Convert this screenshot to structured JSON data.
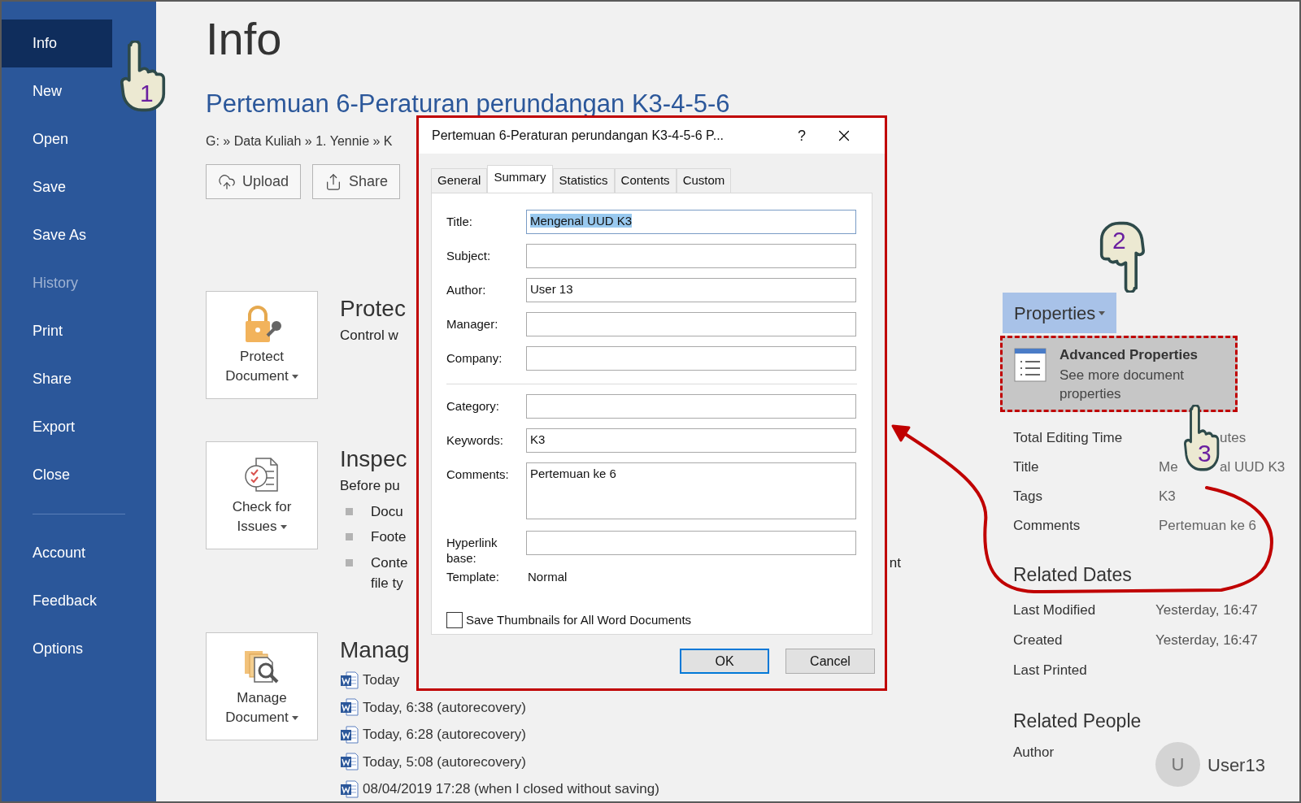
{
  "sidebar": {
    "items": [
      {
        "label": "Info",
        "selected": true,
        "disabled": false
      },
      {
        "label": "New",
        "selected": false,
        "disabled": false
      },
      {
        "label": "Open",
        "selected": false,
        "disabled": false
      },
      {
        "label": "Save",
        "selected": false,
        "disabled": false
      },
      {
        "label": "Save As",
        "selected": false,
        "disabled": false
      },
      {
        "label": "History",
        "selected": false,
        "disabled": true
      },
      {
        "label": "Print",
        "selected": false,
        "disabled": false
      },
      {
        "label": "Share",
        "selected": false,
        "disabled": false
      },
      {
        "label": "Export",
        "selected": false,
        "disabled": false
      },
      {
        "label": "Close",
        "selected": false,
        "disabled": false
      }
    ],
    "lower_items": [
      {
        "label": "Account",
        "selected": false,
        "disabled": false
      },
      {
        "label": "Feedback",
        "selected": false,
        "disabled": false
      },
      {
        "label": "Options",
        "selected": false,
        "disabled": false
      }
    ]
  },
  "page": {
    "heading": "Info",
    "document_title": "Pertemuan 6-Peraturan perundangan K3-4-5-6",
    "path": "G: » Data Kuliah » 1. Yennie » K",
    "actions": [
      {
        "label": "Upload",
        "kind": "upload"
      },
      {
        "label": "Share",
        "kind": "share"
      }
    ]
  },
  "sections": [
    {
      "kind": "protect",
      "tile": "Protect Document",
      "heading": "Protec",
      "lines": [
        "Control w"
      ]
    },
    {
      "kind": "inspect",
      "tile": "Check for Issues",
      "heading": "Inspec",
      "lines": [
        "Before pu"
      ],
      "bullets": [
        {
          "text": "Docu"
        },
        {
          "text": "Foote"
        },
        {
          "text": "Conte",
          "tail": "nt",
          "continuation": "file ty"
        }
      ]
    },
    {
      "kind": "manage",
      "tile": "Manage Document",
      "heading": "Manag",
      "versions": [
        "Today",
        "Today, 6:38 (autorecovery)",
        "Today, 6:28 (autorecovery)",
        "Today, 5:08 (autorecovery)",
        "08/04/2019 17:28 (when I closed without saving)"
      ]
    }
  ],
  "properties": {
    "button": "Properties",
    "menu_item": {
      "title": "Advanced Properties",
      "description": "See more document properties",
      "highlighted": true
    },
    "rows": [
      {
        "label": "Total Editing Time",
        "value_tail": "utes"
      },
      {
        "label": "Title",
        "value": "Me",
        "value_tail": "al UUD K3"
      },
      {
        "label": "Tags",
        "value": "K3"
      },
      {
        "label": "Comments",
        "value": "Pertemuan ke 6"
      }
    ]
  },
  "related_dates": {
    "heading": "Related Dates",
    "rows": [
      {
        "label": "Last Modified",
        "value": "Yesterday, 16:47"
      },
      {
        "label": "Created",
        "value": "Yesterday, 16:47"
      },
      {
        "label": "Last Printed"
      }
    ]
  },
  "related_people": {
    "heading": "Related People",
    "rows": [
      {
        "label": "Author",
        "avatar": "U",
        "name": "User13"
      }
    ]
  },
  "dialog": {
    "title": "Pertemuan 6-Peraturan perundangan K3-4-5-6 P...",
    "help": "?",
    "tabs": [
      {
        "label": "General",
        "selected": false
      },
      {
        "label": "Summary",
        "selected": true
      },
      {
        "label": "Statistics",
        "selected": false
      },
      {
        "label": "Contents",
        "selected": false
      },
      {
        "label": "Custom",
        "selected": false
      }
    ],
    "fields_top": [
      {
        "label": "Title:",
        "value": "Mengenal UUD K3",
        "kind": "text",
        "selected": true
      },
      {
        "label": "Subject:",
        "kind": "text",
        "selected": false
      },
      {
        "label": "Author:",
        "value": "User 13",
        "kind": "text",
        "selected": false
      },
      {
        "label": "Manager:",
        "kind": "text",
        "selected": false
      },
      {
        "label": "Company:",
        "kind": "text",
        "selected": false
      }
    ],
    "fields_bottom": [
      {
        "label": "Category:",
        "kind": "text",
        "selected": false
      },
      {
        "label": "Keywords:",
        "value": "K3",
        "kind": "text",
        "selected": false
      },
      {
        "label": "Comments:",
        "value": "Pertemuan ke 6",
        "kind": "multiline",
        "selected": false
      },
      {
        "label": "Hyperlink base:",
        "kind": "text",
        "selected": false
      }
    ],
    "template": {
      "label": "Template:",
      "value": "Normal"
    },
    "checkbox": {
      "label": "Save Thumbnails for All Word Documents",
      "checked": false
    },
    "buttons": [
      {
        "label": "OK",
        "default": true
      },
      {
        "label": "Cancel",
        "default": false
      }
    ]
  },
  "annotations": [
    {
      "kind": "hand",
      "number": "1"
    },
    {
      "kind": "hand",
      "number": "2"
    },
    {
      "kind": "hand",
      "number": "3"
    }
  ]
}
